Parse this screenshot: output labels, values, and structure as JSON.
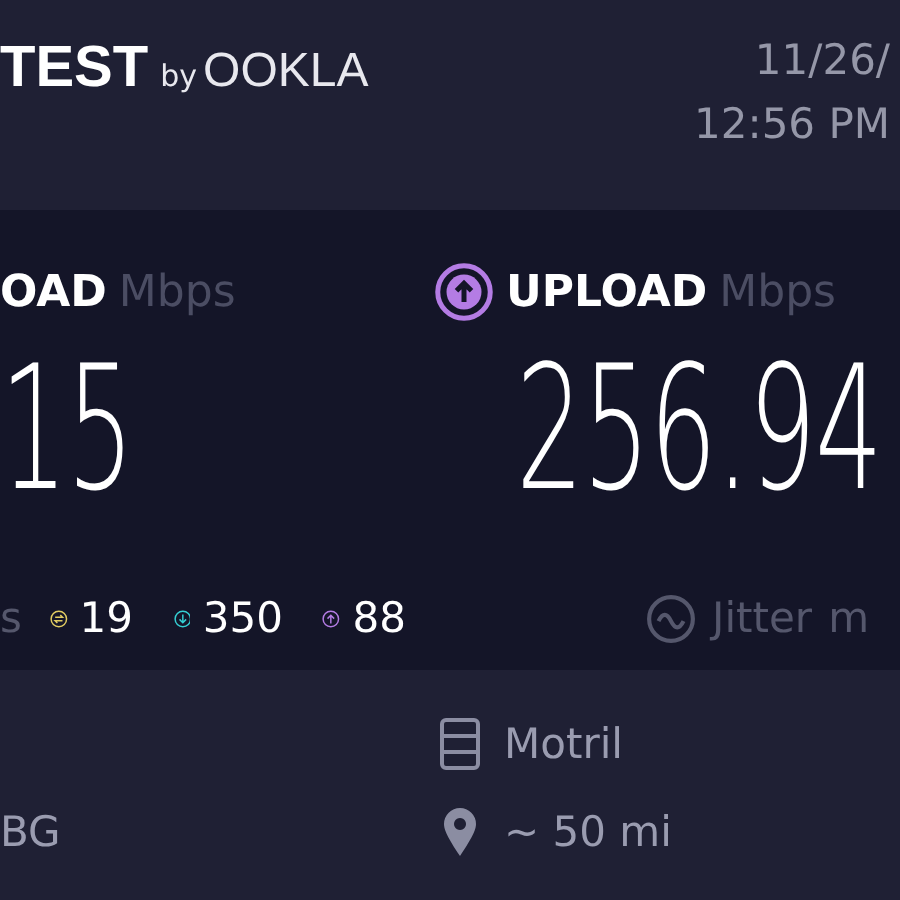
{
  "header": {
    "logo_text": "TEST",
    "logo_by": "by",
    "logo_brand": "OOKLA",
    "date": "11/26/",
    "time": "12:56 PM"
  },
  "results": [
    {
      "kind": "download",
      "label": "OAD",
      "unit": "Mbps",
      "value": "15"
    },
    {
      "kind": "upload",
      "label": "UPLOAD",
      "unit": "Mbps",
      "value": "256.94"
    }
  ],
  "ping": {
    "unit": "s",
    "stats": [
      {
        "kind": "idle",
        "value": "19"
      },
      {
        "kind": "download",
        "value": "350"
      },
      {
        "kind": "upload",
        "value": "88"
      }
    ]
  },
  "jitter": {
    "label": "Jitter",
    "unit": "m"
  },
  "server": {
    "isp": "BG",
    "name": "Motril",
    "distance": "~ 50 mi"
  }
}
